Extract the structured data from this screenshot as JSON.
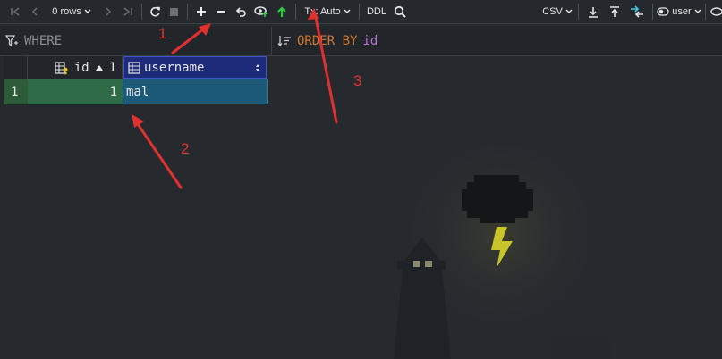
{
  "toolbar": {
    "rows_label": "0 rows",
    "tx_label": "Tx: Auto",
    "ddl_label": "DDL",
    "format_label": "CSV",
    "user_label": "user"
  },
  "filter": {
    "where_placeholder": "WHERE",
    "order_keyword": "ORDER BY",
    "order_column": "id"
  },
  "table": {
    "columns": [
      {
        "name": "id",
        "sort_order": "1"
      },
      {
        "name": "username"
      }
    ],
    "rows": [
      {
        "row_number": "1",
        "id": "1",
        "username": "mal"
      }
    ]
  },
  "annotations": [
    "1",
    "2",
    "3"
  ],
  "colors": {
    "accent_header_bg": "#1d2b7a",
    "row_number_bg": "#2e5b3a",
    "id_cell_bg": "#2f6b47",
    "username_cell_bg": "#1d5a78",
    "annotation_red": "#e03030",
    "keyword_orange": "#cc7832",
    "column_purple": "#b676d6"
  }
}
